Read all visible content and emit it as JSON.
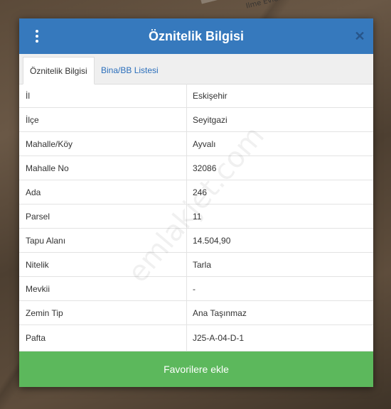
{
  "background": {
    "road_label": "Ilme Evler"
  },
  "header": {
    "title": "Öznitelik Bilgisi",
    "close_symbol": "✕",
    "color": "#3679bd"
  },
  "tabs": [
    {
      "label": "Öznitelik Bilgisi",
      "active": true
    },
    {
      "label": "Bina/BB Listesi",
      "active": false
    }
  ],
  "attributes": [
    {
      "key": "İl",
      "value": "Eskişehir"
    },
    {
      "key": "İlçe",
      "value": "Seyitgazi"
    },
    {
      "key": "Mahalle/Köy",
      "value": "Ayvalı"
    },
    {
      "key": "Mahalle No",
      "value": "32086"
    },
    {
      "key": "Ada",
      "value": "246"
    },
    {
      "key": "Parsel",
      "value": "11"
    },
    {
      "key": "Tapu Alanı",
      "value": "14.504,90"
    },
    {
      "key": "Nitelik",
      "value": "Tarla"
    },
    {
      "key": "Mevkii",
      "value": "-"
    },
    {
      "key": "Zemin Tip",
      "value": "Ana Taşınmaz"
    },
    {
      "key": "Pafta",
      "value": "J25-A-04-D-1"
    }
  ],
  "footer": {
    "button_label": "Favorilere ekle",
    "button_color": "#5cb85c"
  },
  "watermark": "emlakjet.com"
}
